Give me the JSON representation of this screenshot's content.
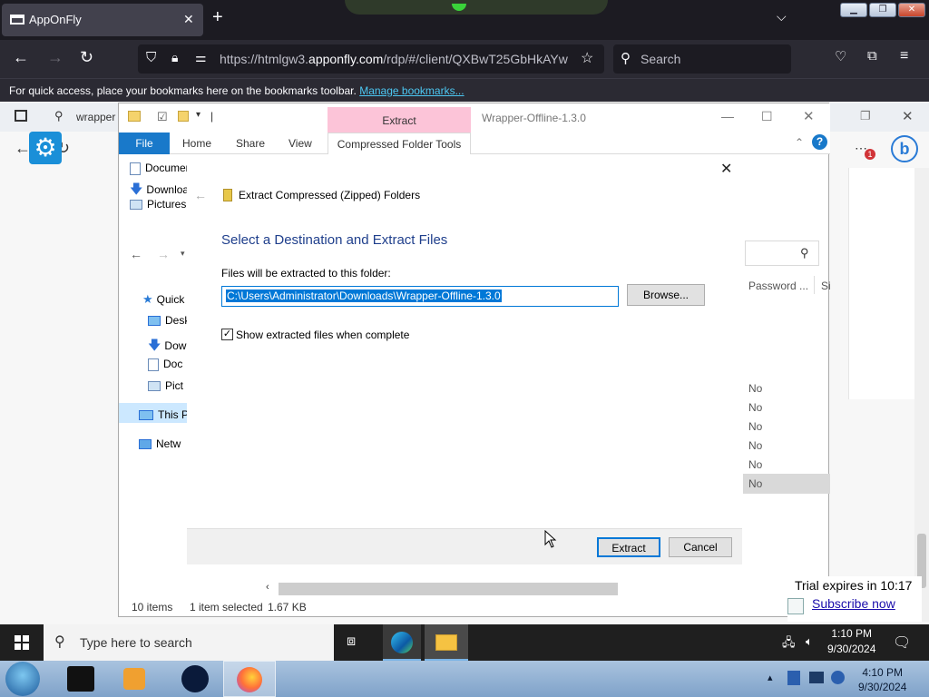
{
  "browser": {
    "tab_title": "AppOnFly",
    "url_prefix": "https://htmlgw3.",
    "url_domain": "apponfly.com",
    "url_rest": "/rdp/#/client/QXBwT25GbHkAYw",
    "search_placeholder": "Search",
    "bookmarks_text": "For quick access, place your bookmarks here on the bookmarks toolbar.",
    "bookmarks_link": "Manage bookmarks..."
  },
  "edge": {
    "tab_text": "wrapper"
  },
  "explorer": {
    "window_title": "Wrapper-Offline-1.3.0",
    "context_tab": "Extract",
    "ribbon_tabs": [
      "File",
      "Home",
      "Share",
      "View"
    ],
    "context_ribbon_tab": "Compressed Folder Tools",
    "quick_items": [
      "Documen",
      "Downloa",
      "Pictures"
    ],
    "nav_items": [
      "Quick",
      "Desk",
      "Dow",
      "Doc",
      "Pict",
      "This P",
      "Netw"
    ],
    "column_header": "Password ...",
    "column_header2": "Si",
    "password_values": [
      "No",
      "No",
      "No",
      "No",
      "No",
      "No"
    ],
    "status_items": "10 items",
    "status_selected": "1 item selected",
    "status_size": "1.67 KB"
  },
  "dialog": {
    "title": "Extract Compressed (Zipped) Folders",
    "heading": "Select a Destination and Extract Files",
    "label": "Files will be extracted to this folder:",
    "path": "C:\\Users\\Administrator\\Downloads\\Wrapper-Offline-1.3.0",
    "browse": "Browse...",
    "checkbox_label": "Show extracted files when complete",
    "checkbox_checked": true,
    "extract": "Extract",
    "cancel": "Cancel"
  },
  "taskbar": {
    "search_placeholder": "Type here to search",
    "time": "1:10 PM",
    "date": "9/30/2024"
  },
  "trial": {
    "expires": "Trial expires in 10:17",
    "subscribe": "Subscribe now"
  },
  "host": {
    "time": "4:10 PM",
    "date": "9/30/2024"
  }
}
